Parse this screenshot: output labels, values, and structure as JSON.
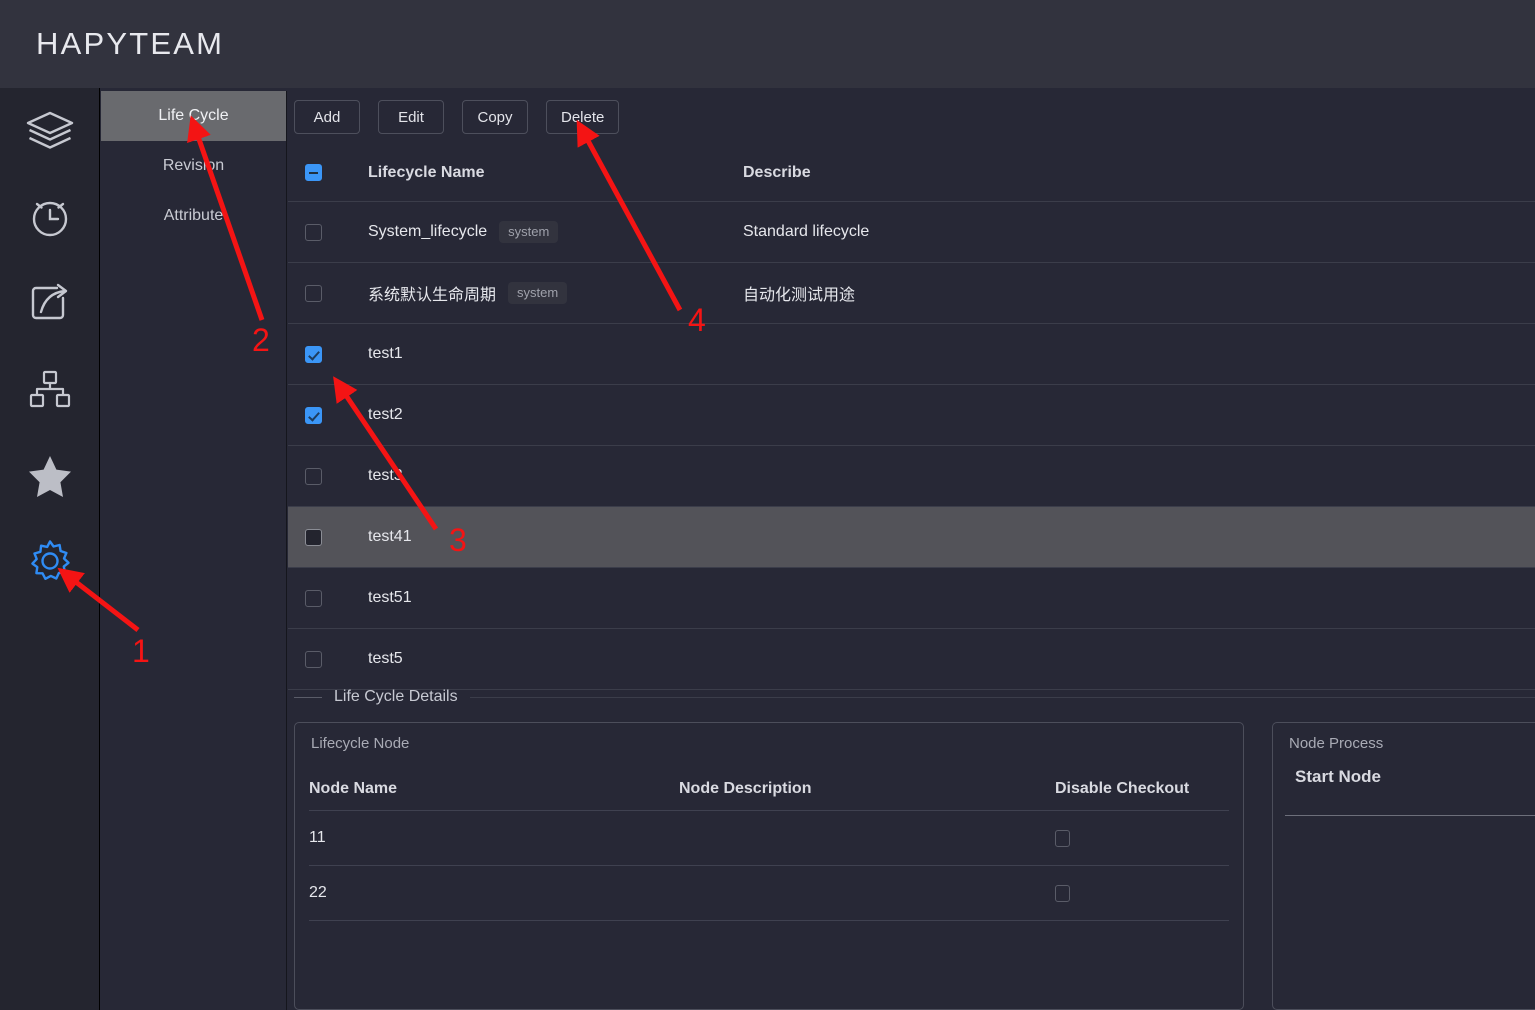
{
  "header": {
    "brand": "HAPYTEAM"
  },
  "icon_rail": {
    "items": [
      {
        "name": "layers-icon",
        "label": "Layers"
      },
      {
        "name": "clock-icon",
        "label": "History"
      },
      {
        "name": "share-icon",
        "label": "Share"
      },
      {
        "name": "sitemap-icon",
        "label": "Structure"
      },
      {
        "name": "star-icon",
        "label": "Favorites"
      },
      {
        "name": "gear-icon",
        "label": "Settings"
      }
    ],
    "active_index": 5,
    "active_color": "#2f8cf5",
    "inactive_color": "#c6c8d0"
  },
  "subnav": {
    "items": [
      {
        "label": "Life Cycle",
        "active": true
      },
      {
        "label": "Revision",
        "active": false
      },
      {
        "label": "Attribute",
        "active": false
      }
    ]
  },
  "toolbar": {
    "buttons": [
      {
        "label": "Add"
      },
      {
        "label": "Edit"
      },
      {
        "label": "Copy"
      },
      {
        "label": "Delete"
      }
    ]
  },
  "lifecycle_table": {
    "header_checkbox_state": "indeterminate",
    "columns": [
      {
        "label": "Lifecycle Name"
      },
      {
        "label": "Describe"
      }
    ],
    "rows": [
      {
        "name": "System_lifecycle",
        "tag": "system",
        "describe": "Standard lifecycle",
        "checkbox": "unchecked",
        "highlighted": false
      },
      {
        "name": "系统默认生命周期",
        "tag": "system",
        "describe": "自动化测试用途",
        "checkbox": "unchecked",
        "highlighted": false
      },
      {
        "name": "test1",
        "tag": "",
        "describe": "",
        "checkbox": "checked",
        "highlighted": false
      },
      {
        "name": "test2",
        "tag": "",
        "describe": "",
        "checkbox": "checked",
        "highlighted": false
      },
      {
        "name": "test3",
        "tag": "",
        "describe": "",
        "checkbox": "unchecked",
        "highlighted": false
      },
      {
        "name": "test41",
        "tag": "",
        "describe": "",
        "checkbox": "filled",
        "highlighted": true
      },
      {
        "name": "test51",
        "tag": "",
        "describe": "",
        "checkbox": "unchecked",
        "highlighted": false
      },
      {
        "name": "test5",
        "tag": "",
        "describe": "",
        "checkbox": "unchecked",
        "highlighted": false
      }
    ]
  },
  "details": {
    "legend": "Life Cycle Details",
    "lifecycle_node_panel": {
      "caption": "Lifecycle Node",
      "columns": [
        {
          "label": "Node Name"
        },
        {
          "label": "Node Description"
        },
        {
          "label": "Disable Checkout"
        }
      ],
      "rows": [
        {
          "node_name": "11",
          "node_description": "",
          "disable_checkout": "unchecked"
        },
        {
          "node_name": "22",
          "node_description": "",
          "disable_checkout": "unchecked"
        }
      ]
    },
    "node_process_panel": {
      "caption": "Node Process",
      "column": "Start Node"
    }
  },
  "annotations": {
    "color": "#f41414",
    "markers": [
      {
        "label": "1",
        "target": "gear-icon"
      },
      {
        "label": "2",
        "target": "subnav-item-life-cycle"
      },
      {
        "label": "3",
        "target": "row-checkbox-test1"
      },
      {
        "label": "4",
        "target": "delete-button"
      }
    ]
  }
}
